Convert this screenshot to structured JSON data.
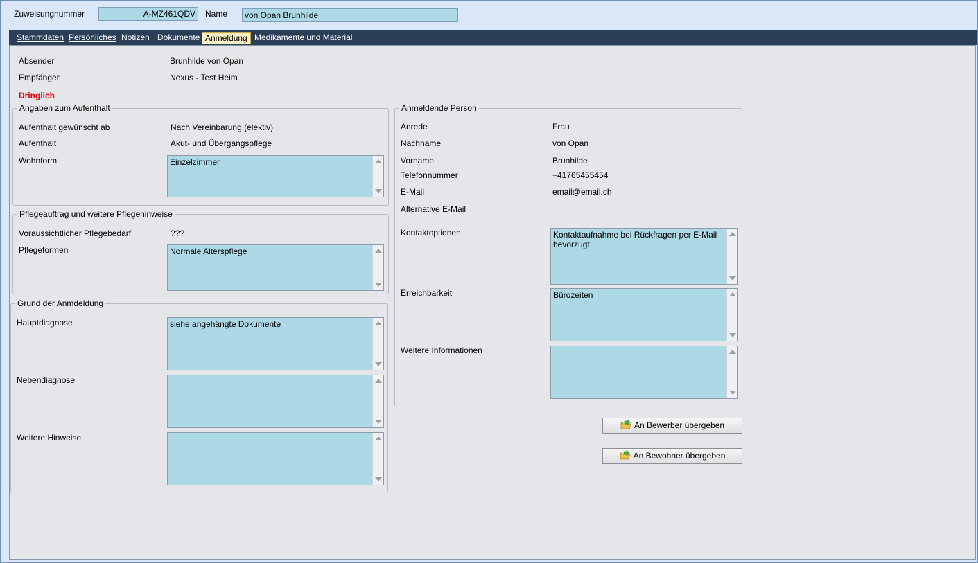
{
  "header": {
    "zuweisung_label": "Zuweisungnummer",
    "zuweisung_value": "A-MZ461QDV",
    "name_label": "Name",
    "name_value": "von Opan Brunhilde"
  },
  "tabs": [
    {
      "label": "Stammdaten"
    },
    {
      "label": "Persönliches"
    },
    {
      "label": "Notizen"
    },
    {
      "label": "Dokumente"
    },
    {
      "label": "Anmeldung"
    },
    {
      "label": "Medikamente und Material"
    }
  ],
  "sender": {
    "label": "Absender",
    "value": "Brunhilde von Opan"
  },
  "receiver": {
    "label": "Empfänger",
    "value": "Nexus - Test Heim"
  },
  "urgent": "Dringlich",
  "aufenthalt": {
    "title": "Angaben zum Aufenthalt",
    "gewuenscht_label": "Aufenthalt gewünscht ab",
    "gewuenscht_value": "Nach Vereinbarung (elektiv)",
    "aufenthalt_label": "Aufenthalt",
    "aufenthalt_value": "Akut- und Übergangspflege",
    "wohnform_label": "Wohnform",
    "wohnform_value": "Einzelzimmer"
  },
  "pflege": {
    "title": "Pflegeauftrag und weitere Pflegehinweise",
    "bedarf_label": "Voraussichtlicher Pflegebedarf",
    "bedarf_value": "???",
    "formen_label": "Pflegeformen",
    "formen_value": "Normale Alterspflege"
  },
  "grund": {
    "title": "Grund der Anmdeldung",
    "haupt_label": "Hauptdiagnose",
    "haupt_value": "siehe angehängte Dokumente",
    "neben_label": "Nebendiagnose",
    "neben_value": "",
    "hinweise_label": "Weitere Hinweise",
    "hinweise_value": ""
  },
  "person": {
    "title": "Anmeldende Person",
    "anrede_label": "Anrede",
    "anrede_value": "Frau",
    "nachname_label": "Nachname",
    "nachname_value": "von Opan",
    "vorname_label": "Vorname",
    "vorname_value": "Brunhilde",
    "telefon_label": "Telefonnummer",
    "telefon_value": "+41765455454",
    "email_label": "E-Mail",
    "email_value": "email@email.ch",
    "alt_email_label": "Alternative E-Mail",
    "alt_email_value": "",
    "kontakt_label": "Kontaktoptionen",
    "kontakt_value": "Kontaktaufnahme bei Rückfragen per E-Mail bevorzugt",
    "erreichbarkeit_label": "Erreichbarkeit",
    "erreichbarkeit_value": "Bürozeiten",
    "weitere_label": "Weitere Informationen",
    "weitere_value": ""
  },
  "buttons": {
    "bewerber": "An Bewerber übergeben",
    "bewohner": "An Bewohner übergeben",
    "icon": "folder-arrow-icon"
  },
  "colors": {
    "field_bg": "#add8e6",
    "tabbar": "#2b3e58",
    "urgent": "#e00000"
  }
}
